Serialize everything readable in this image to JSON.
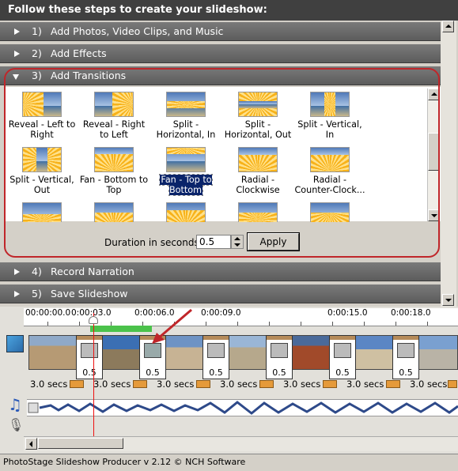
{
  "header": {
    "title": "Follow these steps to create your slideshow:"
  },
  "steps": [
    {
      "num": "1)",
      "label": "Add Photos, Video Clips, and Music"
    },
    {
      "num": "2)",
      "label": "Add Effects"
    },
    {
      "num": "3)",
      "label": "Add Transitions"
    },
    {
      "num": "4)",
      "label": "Record Narration"
    },
    {
      "num": "5)",
      "label": "Save Slideshow"
    }
  ],
  "transitions": [
    {
      "label": "Reveal - Left to Right",
      "icon": "reveal-left-right-icon"
    },
    {
      "label": "Reveal - Right to Left",
      "icon": "reveal-right-left-icon"
    },
    {
      "label": "Split - Horizontal, In",
      "icon": "split-horizontal-in-icon"
    },
    {
      "label": "Split - Horizontal, Out",
      "icon": "split-horizontal-out-icon"
    },
    {
      "label": "Split - Vertical, In",
      "icon": "split-vertical-in-icon"
    },
    {
      "label": "Split - Vertical, Out",
      "icon": "split-vertical-out-icon"
    },
    {
      "label": "Fan - Bottom to Top",
      "icon": "fan-bottom-top-icon"
    },
    {
      "label": "Fan - Top to Bottom",
      "icon": "fan-top-bottom-icon",
      "selected": true
    },
    {
      "label": "Radial - Clockwise",
      "icon": "radial-clockwise-icon"
    },
    {
      "label": "Radial - Counter-Clock...",
      "icon": "radial-counterclockwise-icon"
    }
  ],
  "duration": {
    "label": "Duration in seconds:",
    "value": "0.5",
    "apply_label": "Apply"
  },
  "timeline": {
    "ruler": [
      "00:00:00.0",
      "0:00:03.0",
      "0:00:06.0",
      "0:00:09.0",
      "0:00:15.0",
      "0:00:18.0"
    ],
    "transition_values": [
      "0.5",
      "0.5",
      "0.5",
      "0.5",
      "0.5"
    ],
    "clip_durations": [
      "3.0 secs",
      "3.0 secs",
      "3.0 secs",
      "3.0 secs",
      "3.0 secs",
      "3.0 secs",
      "3.0 secs"
    ]
  },
  "status": {
    "text": "PhotoStage Slideshow Producer v 2.12 © NCH Software"
  },
  "colors": {
    "step_bar": "#6b6b6b",
    "header": "#404040",
    "highlight_frame": "#c0262a",
    "selection": "#0a246a",
    "playhead": "#ee1111",
    "green_bar": "#4bc24b"
  }
}
